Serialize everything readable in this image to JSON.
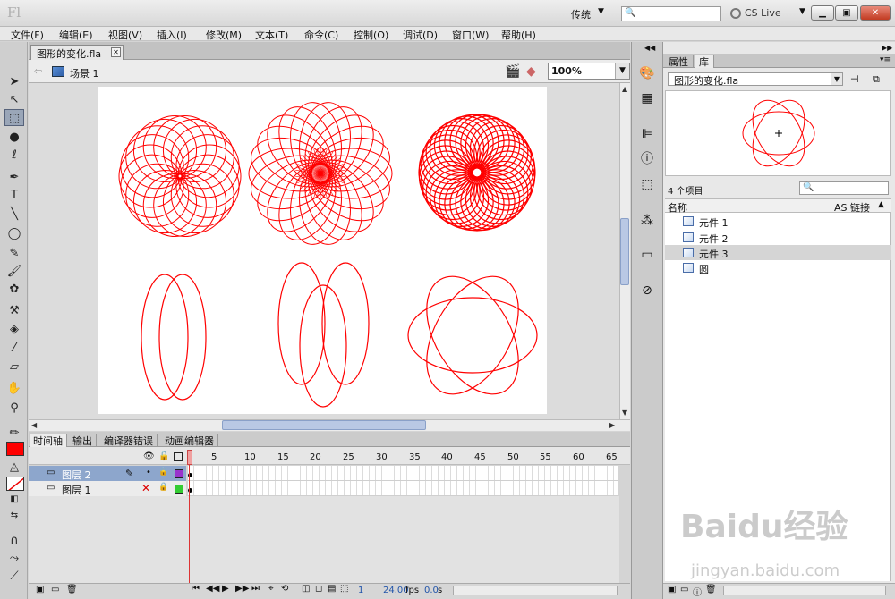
{
  "app": {
    "logo": "Fl",
    "workspace": "传统",
    "cs_live": "CS Live",
    "colors": {
      "accent": "#ff0000",
      "selection": "#8da6cc",
      "stage": "#ffffff"
    }
  },
  "menu": [
    "文件(F)",
    "编辑(E)",
    "视图(V)",
    "插入(I)",
    "修改(M)",
    "文本(T)",
    "命令(C)",
    "控制(O)",
    "调试(D)",
    "窗口(W)",
    "帮助(H)"
  ],
  "document": {
    "tab_title": "图形的变化.fla"
  },
  "scene": {
    "label": "场景 1",
    "zoom": "100%"
  },
  "timeline": {
    "tabs": [
      "时间轴",
      "输出",
      "编译器错误",
      "动画编辑器"
    ],
    "frame_numbers": [
      "5",
      "10",
      "15",
      "20",
      "25",
      "30",
      "35",
      "40",
      "45",
      "50",
      "55",
      "60",
      "65"
    ],
    "layers": [
      {
        "name": "图层 2",
        "selected": true,
        "color": "#9933cc"
      },
      {
        "name": "图层 1",
        "selected": false,
        "color": "#33cc33"
      }
    ],
    "status": {
      "current_frame": "1",
      "fps": "24.00",
      "fps_unit": "fps",
      "time": "0.0",
      "time_unit": "s"
    }
  },
  "library": {
    "tabs": [
      "属性",
      "库"
    ],
    "doc_select": "图形的变化.fla",
    "item_count": "4 个项目",
    "columns": {
      "name": "名称",
      "link": "AS 链接"
    },
    "items": [
      "元件 1",
      "元件 2",
      "元件 3",
      "圆"
    ],
    "selected_index": 2
  },
  "watermark": {
    "brand": "Baidu经验",
    "url": "jingyan.baidu.com"
  }
}
